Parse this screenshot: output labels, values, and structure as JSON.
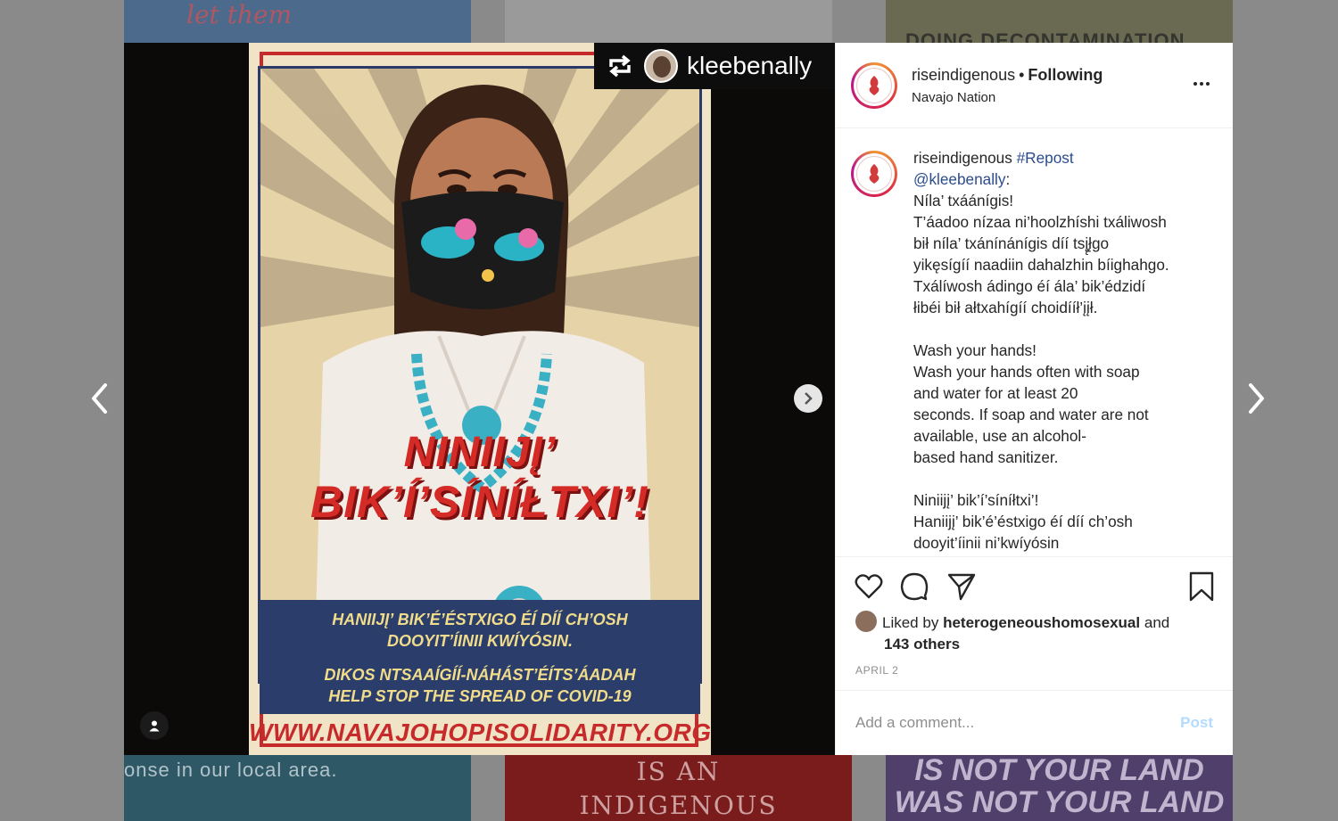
{
  "background": {
    "top_left_text": "let them",
    "top_right_text": "DOING DECONTAMINATION",
    "bottom_left_text": "onse in our local area.",
    "bottom_mid_lines": [
      "IS AN",
      "INDIGENOUS"
    ],
    "bottom_right_lines": [
      "IS NOT YOUR LAND",
      "WAS NOT YOUR LAND"
    ]
  },
  "nav": {
    "prev_icon": "chevron-left-icon",
    "next_icon": "chevron-right-icon"
  },
  "media": {
    "repost_username": "kleebenally",
    "poster": {
      "headline_line1": "NINIIJĮ’",
      "headline_line2": "BIK’Í’SÍNÍŁTXI’!",
      "panel_lines": [
        "HANIIJĮ’ BIK’É’ÉSTXIGO ÉÍ DÍÍ CH’OSH",
        "DOOYIT’ÍINII KWÍYÓSIN.",
        "DIKOS NTSAAÍGÍÍ-NÁHÁST’ÉÍTS’ÁADAH",
        "HELP STOP THE SPREAD OF COVID-19"
      ],
      "url": "WWW.NAVAJOHOPISOLIDARITY.ORG"
    }
  },
  "post": {
    "header": {
      "username": "riseindigenous",
      "separator": "•",
      "follow_status": "Following",
      "location": "Navajo Nation"
    },
    "caption": {
      "username": "riseindigenous",
      "hashtag": "#Repost",
      "mention": "@kleebenally",
      "mention_suffix": ":",
      "lines_navajo": [
        "Níla’ txáánígis!",
        "T’áadoo nízaa ni’hoolzhíshi txáliwosh",
        "bił níla’ txánínánígis díí tsį̨̨ł̨go",
        "yikęsígíí naadiin dahalzhin bíighahgo.",
        "Txálíwosh ádingo éí ála’ bik’édzidí",
        "łibéi bił ałtxahígíí choidííł’įįł."
      ],
      "lines_english": [
        "Wash your hands!",
        "Wash your hands often with soap",
        "and water for at least 20",
        "seconds. If soap and water are not",
        "available, use an alcohol-",
        "based hand sanitizer."
      ],
      "lines_navajo_2": [
        "Niniijį’ bik’í’síníłtxi’!",
        "Haniijį’ bik’é’éstxigo éí díí ch’osh",
        "dooyit’íinii ni’kwíyósin"
      ]
    },
    "likes": {
      "prefix": "Liked by",
      "liker": "heterogeneoushomosexual",
      "joiner": "and",
      "others": "143 others"
    },
    "date": "APRIL 2",
    "comment": {
      "placeholder": "Add a comment...",
      "post_label": "Post"
    }
  },
  "colors": {
    "post_button_disabled": "#b3dbff",
    "hashtag": "#2b4c8c",
    "poster_red": "#d42b27",
    "poster_blue": "#2a3d6b"
  }
}
